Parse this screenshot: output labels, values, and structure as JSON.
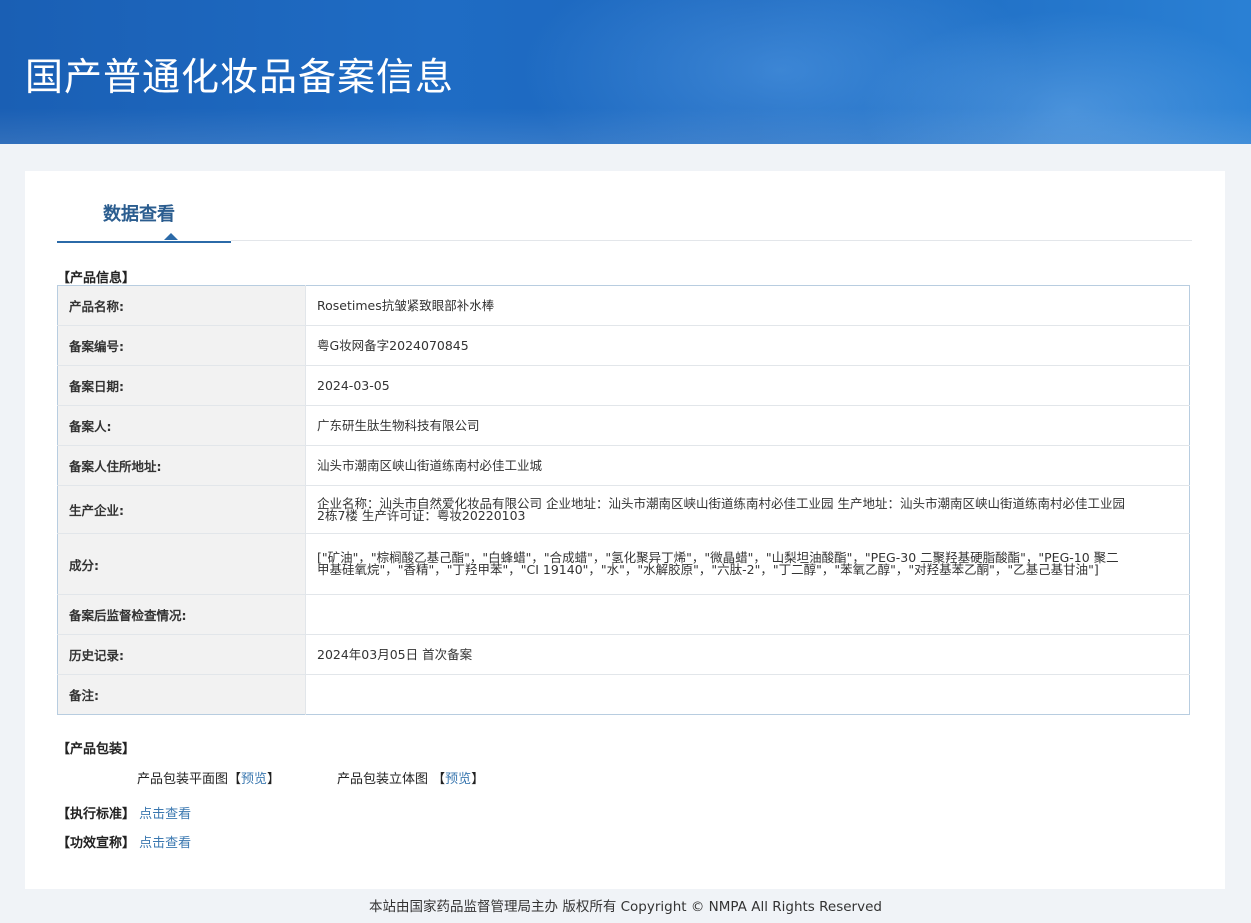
{
  "page": {
    "title": "国产普通化妆品备案信息",
    "tab_label": "数据查看"
  },
  "sections": {
    "product_info": "【产品信息】",
    "packaging": "【产品包装】",
    "standard": "【执行标准】",
    "efficacy": "【功效宣称】"
  },
  "product_info": {
    "rows": [
      {
        "label": "产品名称:",
        "value": "Rosetimes抗皱紧致眼部补水棒"
      },
      {
        "label": "备案编号:",
        "value": "粤G妆网备字2024070845"
      },
      {
        "label": "备案日期:",
        "value": "2024-03-05"
      },
      {
        "label": "备案人:",
        "value": "广东研生肽生物科技有限公司"
      },
      {
        "label": "备案人住所地址:",
        "value": "汕头市潮南区峡山街道练南村必佳工业城"
      },
      {
        "label": "生产企业:",
        "value": "企业名称：汕头市自然爱化妆品有限公司 企业地址：汕头市潮南区峡山街道练南村必佳工业园 生产地址：汕头市潮南区峡山街道练南村必佳工业园2栋7楼 生产许可证：粤妆20220103"
      },
      {
        "label": "成分:",
        "value": "[\"矿油\"，\"棕榈酸乙基己酯\"，\"白蜂蜡\"，\"合成蜡\"，\"氢化聚异丁烯\"，\"微晶蜡\"，\"山梨坦油酸酯\"，\"PEG-30 二聚羟基硬脂酸酯\"，\"PEG-10 聚二甲基硅氧烷\"，\"香精\"，\"丁羟甲苯\"，\"CI 19140\"，\"水\"，\"水解胶原\"，\"六肽-2\"，\"丁二醇\"，\"苯氧乙醇\"，\"对羟基苯乙酮\"，\"乙基己基甘油\"]"
      },
      {
        "label": "备案后监督检查情况:",
        "value": ""
      },
      {
        "label": "历史记录:",
        "value": "2024年03月05日 首次备案"
      },
      {
        "label": "备注:",
        "value": ""
      }
    ]
  },
  "packaging": {
    "flat_label": "产品包装平面图",
    "flat_link": "预览",
    "solid_label": "产品包装立体图",
    "solid_link": "预览",
    "bracket_open": "【",
    "bracket_close": "】"
  },
  "links": {
    "standard_link": "点击查看",
    "efficacy_link": "点击查看"
  },
  "footer": {
    "text": "本站由国家药品监督管理局主办 版权所有 Copyright © NMPA All Rights Reserved"
  }
}
